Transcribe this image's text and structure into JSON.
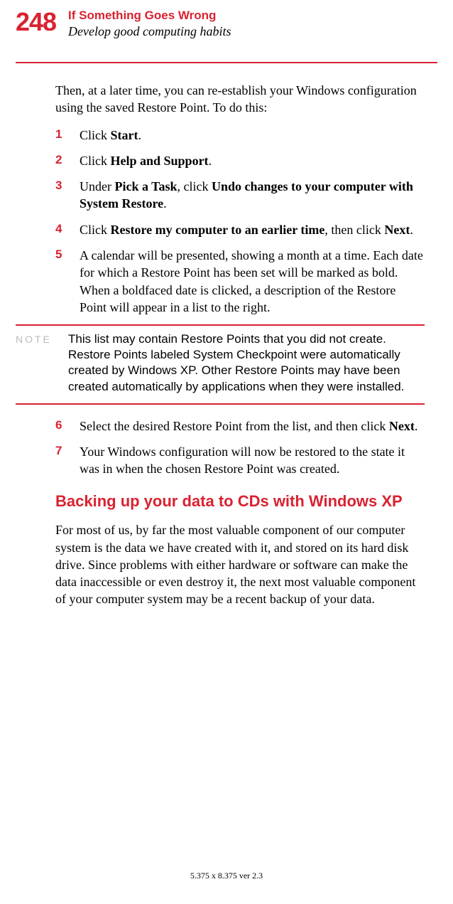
{
  "pageNumber": "248",
  "chapterTitle": "If Something Goes Wrong",
  "sectionTitle": "Develop good computing habits",
  "intro": "Then, at a later time, you can re-establish your Windows configuration using the saved Restore Point. To do this:",
  "steps": {
    "s1": {
      "num": "1",
      "pre": "Click ",
      "b1": "Start",
      "post": "."
    },
    "s2": {
      "num": "2",
      "pre": "Click ",
      "b1": "Help and Support",
      "post": "."
    },
    "s3": {
      "num": "3",
      "pre": "Under ",
      "b1": "Pick a Task",
      "mid": ", click ",
      "b2": "Undo changes to your computer with System Restore",
      "post": "."
    },
    "s4": {
      "num": "4",
      "pre": "Click ",
      "b1": "Restore my computer to an earlier time",
      "mid": ", then click ",
      "b2": "Next",
      "post": "."
    },
    "s5": {
      "num": "5",
      "text": "A calendar will be presented, showing a month at a time. Each date for which a Restore Point has been set will be marked as bold. When a boldfaced date is clicked, a description of the Restore Point will appear in a list to the right."
    },
    "s6": {
      "num": "6",
      "pre": "Select the desired Restore Point from the list, and then click ",
      "b1": "Next",
      "post": "."
    },
    "s7": {
      "num": "7",
      "text": "Your Windows configuration will now be restored to the state it was in when the chosen Restore Point was created."
    }
  },
  "noteLabel": "NOTE",
  "noteText": "This list may contain Restore Points that you did not create. Restore Points labeled System Checkpoint were automatically created by Windows XP. Other Restore Points may have been created automatically by applications when they were installed.",
  "subheading": "Backing up your data to CDs with Windows XP",
  "bodyPara": "For most of us, by far the most valuable component of our computer system is the data we have created with it, and stored on its hard disk drive. Since problems with either hardware or software can make the data inaccessible or even destroy it, the next most valuable component of your computer system may be a recent backup of your data.",
  "footer": "5.375 x 8.375 ver 2.3"
}
